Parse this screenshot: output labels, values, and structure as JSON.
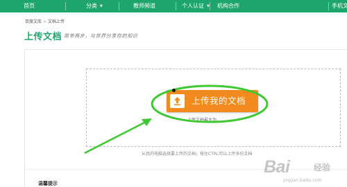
{
  "nav": {
    "items": [
      {
        "label": "首页"
      },
      {
        "label": "分类",
        "dropdown": true
      },
      {
        "label": "教师频道"
      },
      {
        "label": "个人认证",
        "dropdown": true
      },
      {
        "label": "机构合作"
      },
      {
        "label": "手机文"
      }
    ]
  },
  "breadcrumb": {
    "home": "百度文库",
    "separator": ">",
    "current": "文档上传"
  },
  "header": {
    "title": "上传文档",
    "slogan": "简单两步，与世界分享你的知识"
  },
  "upload": {
    "button_label": "上传我的文档",
    "size_tip": "上传文档最大为",
    "hint": "从我的电脑选择要上传的文档；按住CTRL可以上传多份文档"
  },
  "notice": {
    "title": "温馨提示"
  },
  "watermark": {
    "brand": "Bai",
    "brand_cn": "经验",
    "url": "jingyan.baidu.com"
  },
  "colors": {
    "nav_bg": "#1ea56d",
    "title_green": "#1ea56d",
    "button_orange": "#f28a1e",
    "annotation_green": "#3ec832"
  }
}
